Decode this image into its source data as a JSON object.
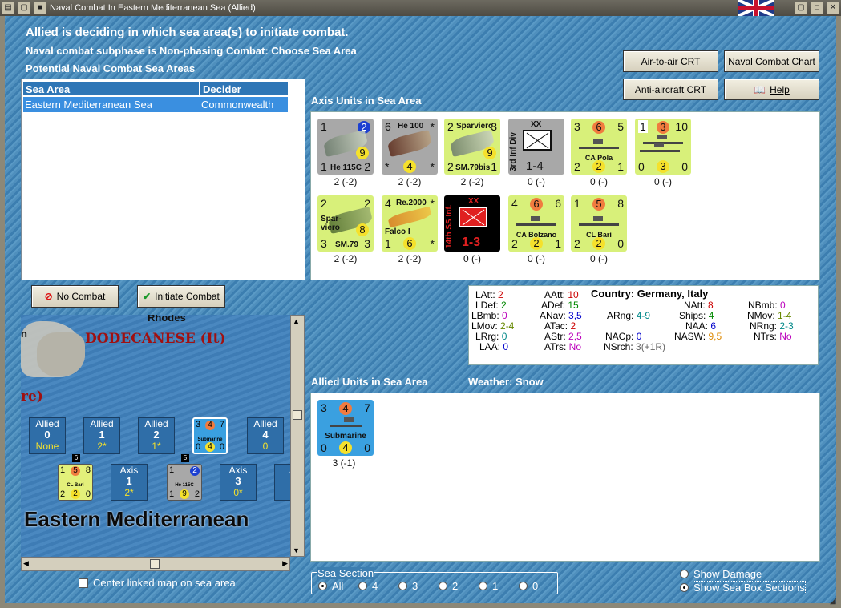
{
  "window": {
    "title": "Naval Combat In Eastern Mediterranean Sea (Allied)"
  },
  "messages": {
    "line1": "Allied is deciding in which sea area(s) to initiate combat.",
    "line2": "Naval combat subphase is Non-phasing Combat: Choose Sea Area",
    "line3": "Potential Naval Combat Sea Areas"
  },
  "buttons": {
    "air_to_air": "Air-to-air CRT",
    "naval_chart": "Naval Combat Chart",
    "anti_aircraft": "Anti-aircraft CRT",
    "help": "Help",
    "no_combat": "No Combat",
    "initiate": "Initiate Combat"
  },
  "table": {
    "headers": [
      "Sea Area",
      "Decider"
    ],
    "rows": [
      [
        "Eastern Mediterranean Sea",
        "Commonwealth"
      ]
    ]
  },
  "axis": {
    "label": "Axis Units in Sea Area",
    "units": [
      {
        "name": "He 115C",
        "tl": "1",
        "tr": "2",
        "mid": "9",
        "bl": "1",
        "br": "2",
        "below": "2 (-2)"
      },
      {
        "name": "He 100",
        "tl": "6",
        "tr": "*",
        "mid": "",
        "bl": "*",
        "bc": "4",
        "br": "*",
        "below": "2 (-2)"
      },
      {
        "name": "Sparviero",
        "name2": "SM.79bis",
        "tl": "2",
        "tr": "3",
        "mid": "9",
        "bl": "2",
        "br": "1",
        "below": "2 (-2)"
      },
      {
        "name": "3rd Inf Div",
        "tl": "XX",
        "bc": "1-4",
        "below": "0 (-)"
      },
      {
        "name": "CA Pola",
        "tl": "3",
        "tc": "6",
        "tr": "5",
        "bl": "2",
        "bc": "2",
        "br": "1",
        "below": "0 (-)"
      },
      {
        "name": "",
        "tl": "1",
        "tc": "3",
        "tr": "10",
        "bl": "0",
        "bc": "3",
        "br": "0",
        "below": "0 (-)"
      },
      {
        "name": "Spar- viero",
        "name2": "SM.79",
        "tl": "2",
        "tr": "2",
        "mid": "8",
        "bl": "3",
        "br": "3",
        "below": "2 (-2)"
      },
      {
        "name": "Re.2000",
        "name2": "Falco I",
        "tl": "4",
        "tr": "*",
        "bl": "1",
        "bc": "6",
        "br": "*",
        "below": "2 (-2)"
      },
      {
        "name": "14th SS Inf.",
        "tl": "XX",
        "bc": "1-3",
        "below": "0 (-)"
      },
      {
        "name": "CA Bolzano",
        "tl": "4",
        "tc": "6",
        "tr": "6",
        "bl": "2",
        "bc": "2",
        "br": "1",
        "below": "0 (-)"
      },
      {
        "name": "CL Bari",
        "tl": "1",
        "tc": "5",
        "tr": "8",
        "bl": "2",
        "bc": "2",
        "br": "0",
        "below": "0 (-)"
      }
    ]
  },
  "stats": {
    "LAtt": "2",
    "LDef": "2",
    "LBmb": "0",
    "LMov": "2-4",
    "LRrg": "0",
    "LAA": "0",
    "AAtt": "10",
    "ADef": "15",
    "ANav": "3,5",
    "ATac": "2",
    "AStr": "2,5",
    "ATrs": "No",
    "country": "Country: Germany, Italy",
    "ARng": "4-9",
    "NACp": "0",
    "NSrch": "3(+1R)",
    "NAtt": "8",
    "Ships": "4",
    "NAA": "6",
    "NASW": "9,5",
    "NBmb": "0",
    "NMov": "1-4",
    "NRng": "2-3",
    "NTrs": "No"
  },
  "allied": {
    "label": "Allied Units in Sea Area",
    "weather": "Weather:  Snow",
    "units": [
      {
        "name": "Submarine",
        "tl": "3",
        "tc": "4",
        "tr": "7",
        "bl": "0",
        "bc": "4",
        "br": "0",
        "below": "3 (-1)"
      }
    ]
  },
  "map": {
    "rhodes": "Rhodes",
    "dodecanese": "DODECANESE (It)",
    "frag1": "n",
    "frag2": "re)",
    "sea_name": "Eastern Mediterranean",
    "top_boxes": [
      {
        "side": "Allied",
        "num": "0",
        "val": "None"
      },
      {
        "side": "Allied",
        "num": "1",
        "val": "2*"
      },
      {
        "side": "Allied",
        "num": "2",
        "val": "1*"
      },
      {
        "side": "Allied",
        "num": "4",
        "val": "0"
      }
    ],
    "bottom_boxes": [
      {
        "side": "Axis",
        "num": "1",
        "val": "2*"
      },
      {
        "side": "Axis",
        "num": "3",
        "val": "0*"
      },
      {
        "side": "A",
        "num": "",
        "val": ""
      }
    ],
    "stack_labels": [
      "6",
      "5"
    ],
    "counter_bari": {
      "tl": "1",
      "tc": "5",
      "tr": "8",
      "nm": "CL Bari",
      "bl": "2",
      "bc": "2",
      "br": "0"
    },
    "counter_he115": {
      "tl": "1",
      "tr": "2",
      "nm": "He 115C",
      "bc": "9",
      "bl": "1",
      "br": "2"
    },
    "counter_sub": {
      "tl": "3",
      "tc": "4",
      "tr": "7",
      "nm": "Submarine",
      "bl": "0",
      "bc": "4",
      "br": "0"
    }
  },
  "options": {
    "center_map": "Center linked map on sea area",
    "sea_section": "Sea Section",
    "sections": [
      "All",
      "4",
      "3",
      "2",
      "1",
      "0"
    ],
    "show_damage": "Show Damage",
    "show_boxes": "Show Sea Box Sections"
  }
}
